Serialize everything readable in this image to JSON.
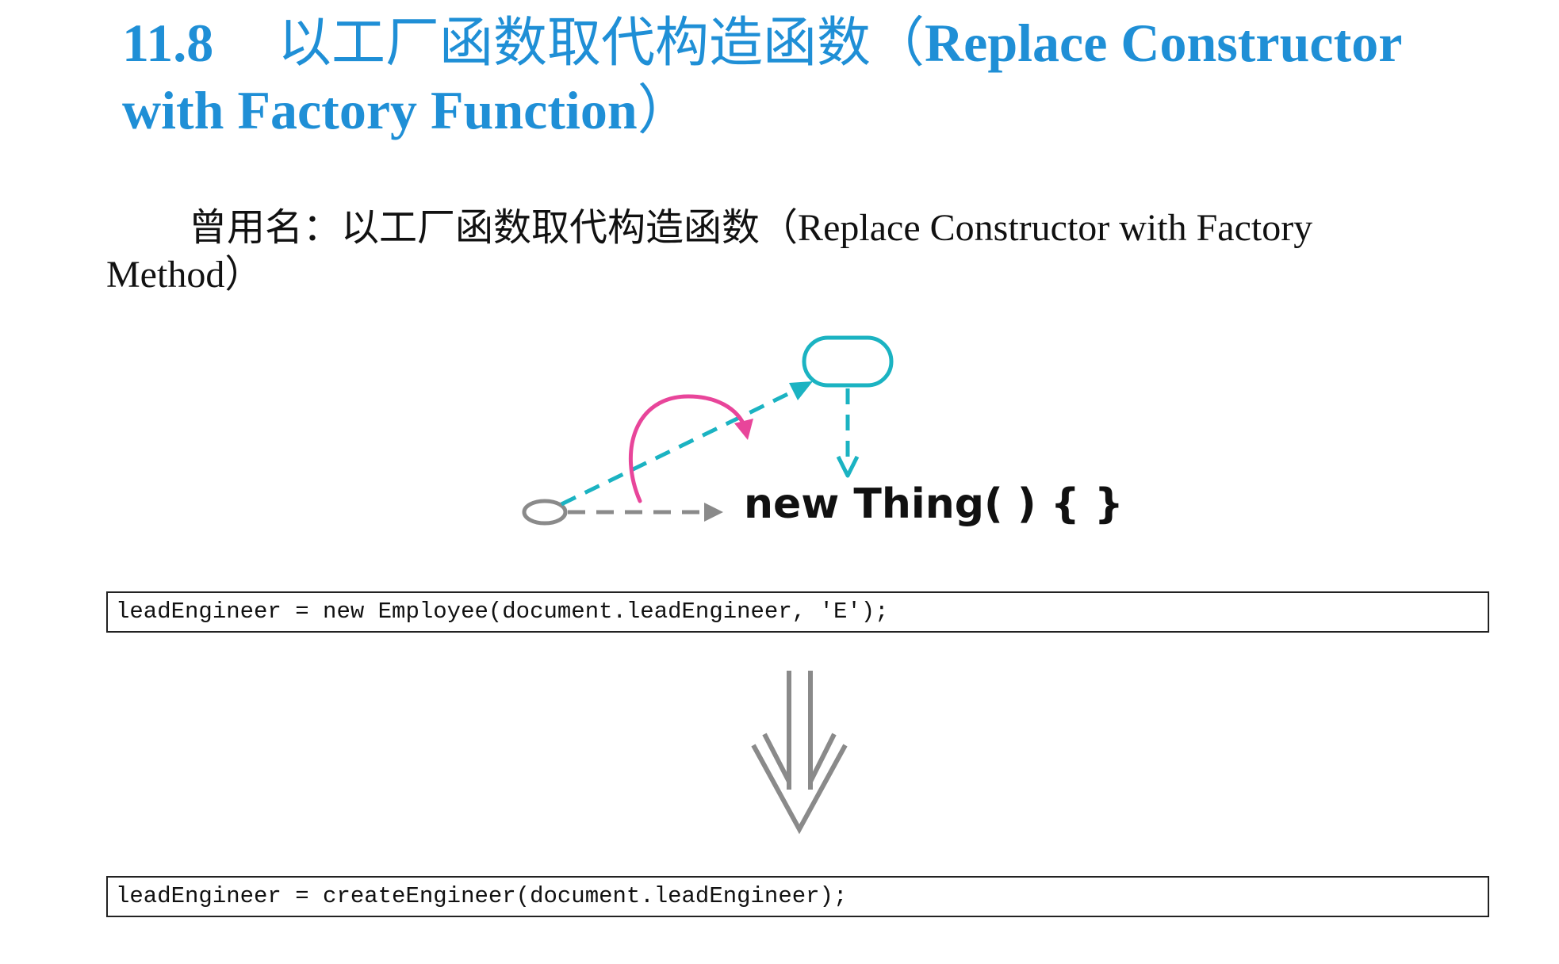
{
  "section": {
    "number": "11.8",
    "title_cn": "以工厂函数取代构造函数",
    "title_en_open": "（",
    "title_en": "Replace Constructor with Factory Function",
    "title_en_close": "）"
  },
  "aka": {
    "label": "曾用名：",
    "name_cn": "以工厂函数取代构造函数",
    "open_paren": "（",
    "name_en": "Replace Constructor with Factory Method",
    "close_paren": "）"
  },
  "diagram": {
    "code_text": "new Thing( ) {  }",
    "colors": {
      "teal": "#1bb3c2",
      "pink": "#e8459a",
      "gray": "#8a8a8a"
    }
  },
  "code": {
    "before": "leadEngineer = new Employee(document.leadEngineer, 'E');",
    "after": "leadEngineer = createEngineer(document.leadEngineer);"
  }
}
